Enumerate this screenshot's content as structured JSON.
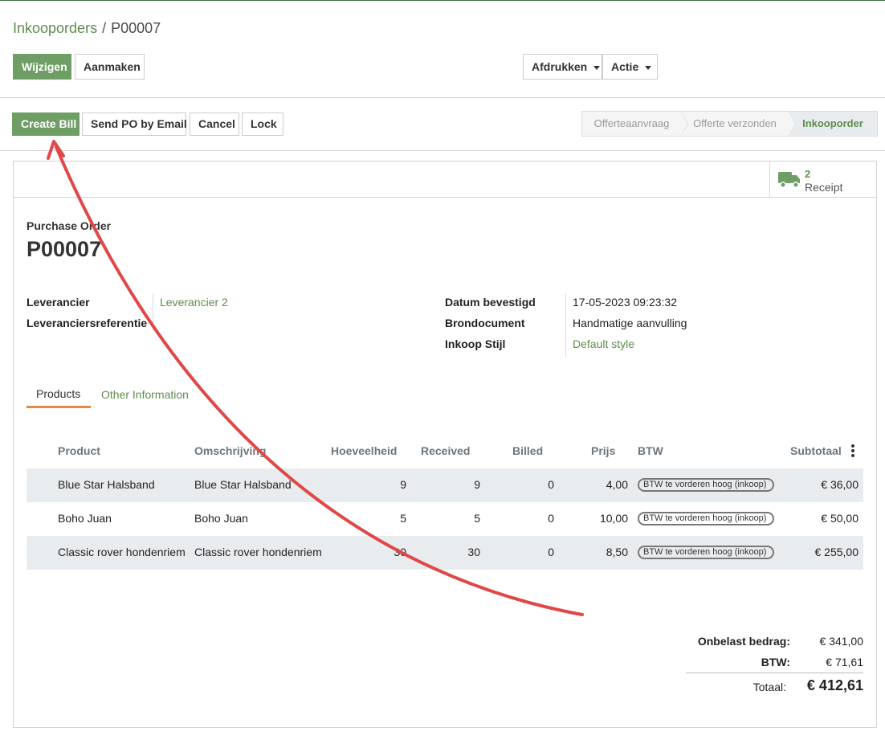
{
  "breadcrumb": {
    "parent": "Inkooporders",
    "separator": "/",
    "current": "P00007"
  },
  "control": {
    "edit_label": "Wijzigen",
    "create_label": "Aanmaken",
    "print_label": "Afdrukken",
    "action_label": "Actie"
  },
  "actions": {
    "create_bill": "Create Bill",
    "send_po": "Send PO by Email",
    "cancel": "Cancel",
    "lock": "Lock"
  },
  "status": {
    "steps": [
      "Offerteaanvraag",
      "Offerte verzonden",
      "Inkooporder"
    ],
    "active": "Inkooporder"
  },
  "smart_button": {
    "count": "2",
    "label": "Receipt",
    "icon": "truck-icon"
  },
  "document": {
    "type": "Purchase Order",
    "name": "P00007"
  },
  "fields": {
    "vendor_label": "Leverancier",
    "vendor_value": "Leverancier 2",
    "vendor_ref_label": "Leveranciersreferentie",
    "date_label": "Datum bevestigd",
    "date_value": "17-05-2023 09:23:32",
    "source_label": "Brondocument",
    "source_value": "Handmatige aanvulling",
    "style_label": "Inkoop Stijl",
    "style_value": "Default style"
  },
  "tabs": [
    {
      "label": "Products"
    },
    {
      "label": "Other Information"
    }
  ],
  "table": {
    "headers": [
      "Product",
      "Omschrijving",
      "Hoeveelheid",
      "Received",
      "Billed",
      "Prijs",
      "BTW",
      "Subtotaal"
    ],
    "rows": [
      {
        "product": "Blue Star Halsband",
        "description": "Blue Star Halsband",
        "qty": "9",
        "received": "9",
        "billed": "0",
        "price": "4,00",
        "tax": "BTW te vorderen hoog (inkoop)",
        "subtotal": "€ 36,00"
      },
      {
        "product": "Boho Juan",
        "description": "Boho Juan",
        "qty": "5",
        "received": "5",
        "billed": "0",
        "price": "10,00",
        "tax": "BTW te vorderen hoog (inkoop)",
        "subtotal": "€ 50,00"
      },
      {
        "product": "Classic rover hondenriem",
        "description": "Classic rover hondenriem",
        "qty": "30",
        "received": "30",
        "billed": "0",
        "price": "8,50",
        "tax": "BTW te vorderen hoog (inkoop)",
        "subtotal": "€ 255,00"
      }
    ]
  },
  "totals": {
    "untaxed_label": "Onbelast bedrag:",
    "untaxed_value": "€ 341,00",
    "tax_label": "BTW:",
    "tax_value": "€ 71,61",
    "total_label": "Totaal:",
    "total_value": "€ 412,61"
  },
  "colors": {
    "primary": "#6f9e65",
    "link": "#5e8c4d",
    "annotation": "#e04848",
    "tab_accent": "#e8874a"
  }
}
